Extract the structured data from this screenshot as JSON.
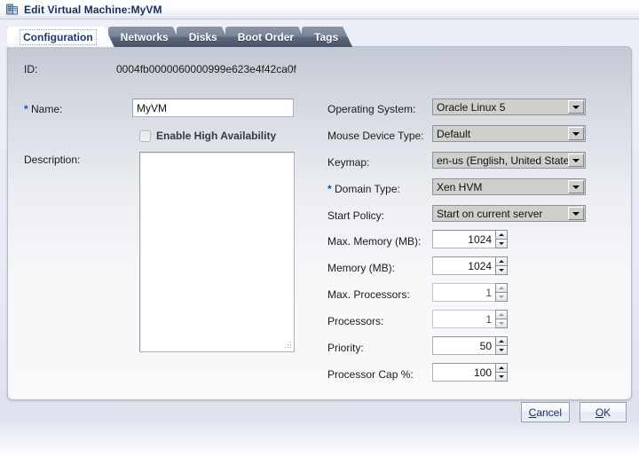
{
  "window": {
    "title": "Edit Virtual Machine:MyVM",
    "icon": "server-icon"
  },
  "tabs": [
    {
      "label": "Configuration",
      "active": true
    },
    {
      "label": "Networks",
      "active": false
    },
    {
      "label": "Disks",
      "active": false
    },
    {
      "label": "Boot Order",
      "active": false
    },
    {
      "label": "Tags",
      "active": false
    }
  ],
  "form": {
    "id": {
      "label": "ID:",
      "value": "0004fb0000060000999e623e4f42ca0f"
    },
    "name": {
      "label": "Name:",
      "required": "*",
      "value": "MyVM"
    },
    "high_availability": {
      "label": "Enable High Availability",
      "checked": false
    },
    "description": {
      "label": "Description:",
      "value": "",
      "placeholder": ""
    },
    "operating_system": {
      "label": "Operating System:",
      "value": "Oracle Linux 5"
    },
    "mouse_device_type": {
      "label": "Mouse Device Type:",
      "value": "Default"
    },
    "keymap": {
      "label": "Keymap:",
      "value": "en-us (English, United State"
    },
    "domain_type": {
      "label": "Domain Type:",
      "required": "*",
      "value": "Xen HVM"
    },
    "start_policy": {
      "label": "Start Policy:",
      "value": "Start on current server"
    },
    "max_memory": {
      "label": "Max. Memory (MB):",
      "value": "1024"
    },
    "memory": {
      "label": "Memory (MB):",
      "value": "1024"
    },
    "max_processors": {
      "label": "Max. Processors:",
      "value": "1"
    },
    "processors": {
      "label": "Processors:",
      "value": "1"
    },
    "priority": {
      "label": "Priority:",
      "value": "50"
    },
    "processor_cap": {
      "label": "Processor Cap %:",
      "value": "100"
    }
  },
  "buttons": {
    "cancel": {
      "mnemonic": "C",
      "rest": "ancel"
    },
    "ok": {
      "mnemonic": "O",
      "rest": "K"
    }
  }
}
